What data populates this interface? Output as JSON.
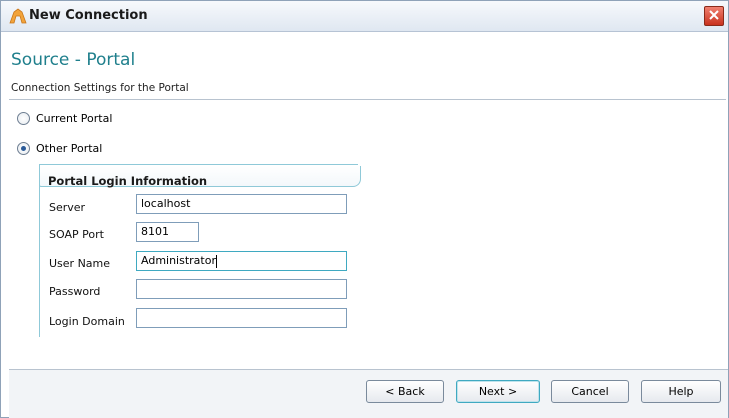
{
  "window": {
    "title": "New Connection"
  },
  "header": {
    "title": "Source - Portal",
    "subtitle": "Connection Settings for the Portal"
  },
  "options": {
    "current_portal": {
      "label": "Current Portal",
      "selected": false
    },
    "other_portal": {
      "label": "Other Portal",
      "selected": true
    }
  },
  "login_group": {
    "title": "Portal Login Information",
    "fields": [
      {
        "label": "Server",
        "value": "localhost"
      },
      {
        "label": "SOAP Port",
        "value": "8101"
      },
      {
        "label": "User Name",
        "value": "Administrator"
      },
      {
        "label": "Password",
        "value": ""
      },
      {
        "label": "Login Domain",
        "value": ""
      }
    ]
  },
  "buttons": {
    "back": "< Back",
    "next": "Next >",
    "cancel": "Cancel",
    "help": "Help"
  },
  "icons": {
    "app": "portal-app-icon",
    "close": "close-icon"
  },
  "colors": {
    "accent": "#1f7f8c",
    "focus": "#3fa9c1",
    "close": "#c8321e"
  }
}
